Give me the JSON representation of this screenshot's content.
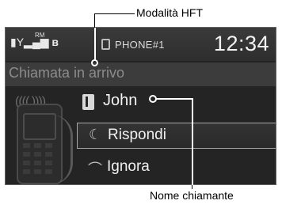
{
  "callouts": {
    "hft_mode": "Modalità HFT",
    "caller_name": "Nome chiamante"
  },
  "status_bar": {
    "signal_label": "RM",
    "phone_label": "PHONE#1",
    "clock": "12:34",
    "icons": [
      "battery-icon",
      "signal-icon",
      "bluetooth-icon",
      "phone-icon"
    ]
  },
  "screen": {
    "subtitle": "Chiamata in arrivo",
    "caller": "John",
    "menu": [
      {
        "label": "Rispondi",
        "icon": "answer-phone-icon",
        "selected": true
      },
      {
        "label": "Ignora",
        "icon": "hangup-phone-icon",
        "selected": false
      }
    ]
  }
}
